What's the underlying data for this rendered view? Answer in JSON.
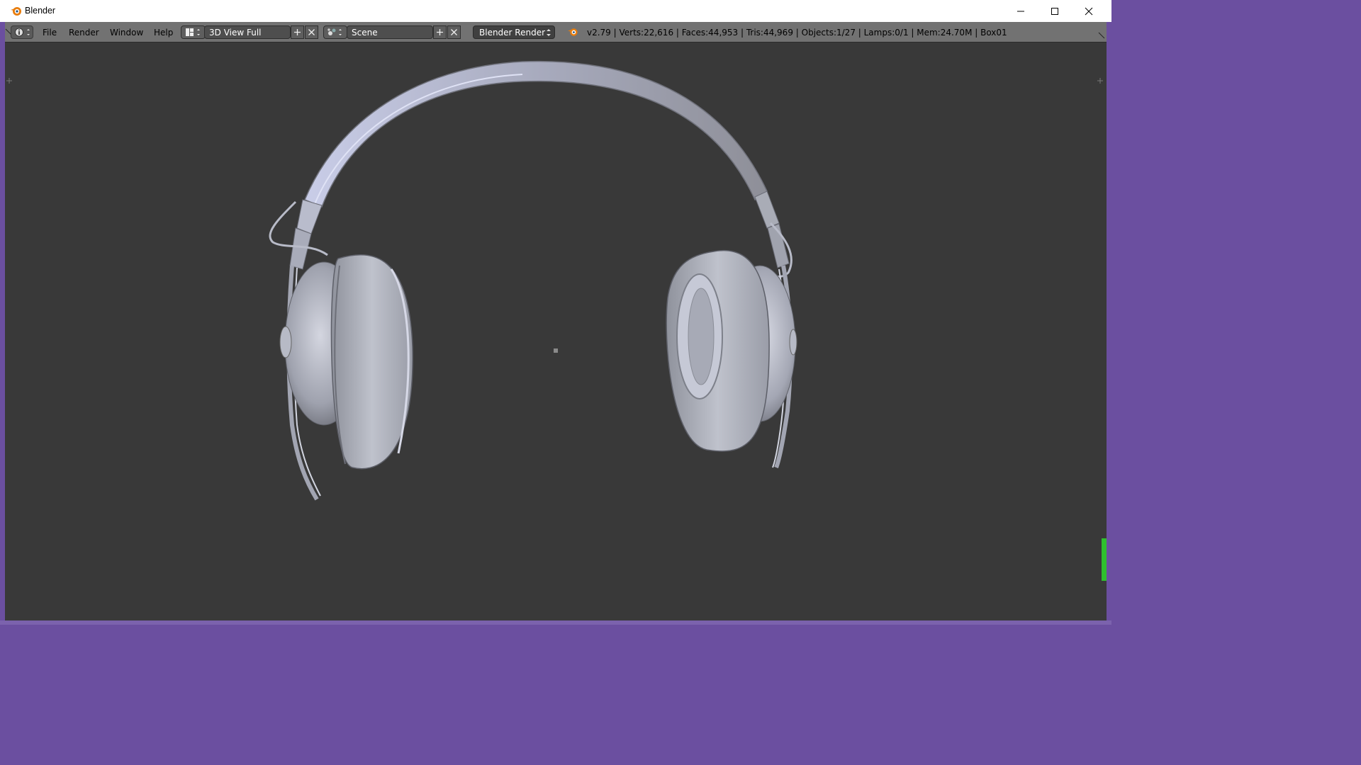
{
  "window": {
    "title": "Blender",
    "app_icon": "blender-logo-icon",
    "controls": [
      "minimize-icon",
      "maximize-icon",
      "close-icon"
    ]
  },
  "menubar": {
    "editor_type_icon": "info-icon",
    "menus": [
      "File",
      "Render",
      "Window",
      "Help"
    ],
    "screen_layout": {
      "icon": "screen-layout-icon",
      "value": "3D View Full"
    },
    "scene": {
      "icon": "scene-icon",
      "value": "Scene"
    },
    "render_engine": "Blender Render",
    "stats": "v2.79 | Verts:22,616 | Faces:44,953 | Tris:44,969 | Objects:1/27 | Lamps:0/1 | Mem:24.70M | Box01"
  },
  "viewport": {
    "content": "headphones-model",
    "background_color": "#393939",
    "model_color": "#b9bcc8"
  },
  "colors": {
    "menubar": "#727272",
    "window_border": "#6b4fa0",
    "accent_green": "#2fbf2f"
  }
}
